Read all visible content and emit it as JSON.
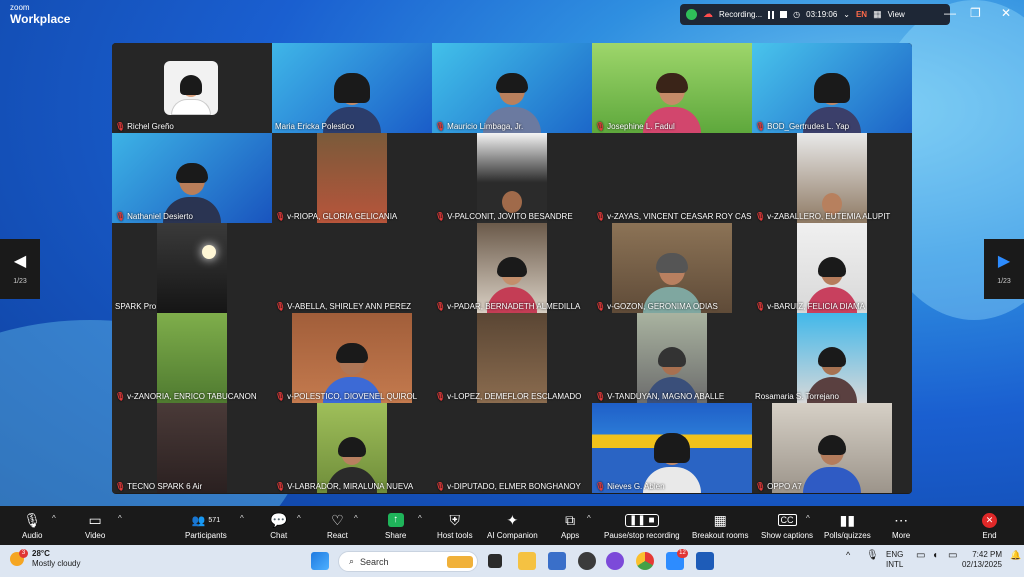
{
  "app": {
    "brand_top": "zoom",
    "brand_bottom": "Workplace"
  },
  "recording": {
    "label": "Recording...",
    "timer": "03:19:06",
    "language": "EN",
    "view_label": "View"
  },
  "navigation": {
    "left_page": "1/23",
    "right_page": "1/23"
  },
  "participants": [
    {
      "name": "Richel Greño"
    },
    {
      "name": "Maria Ericka Polestico"
    },
    {
      "name": "Mauricio Limbaga, Jr."
    },
    {
      "name": "Josephine L. Fadul"
    },
    {
      "name": "BOD_Gertrudes L. Yap"
    },
    {
      "name": "Nathaniel Desierto"
    },
    {
      "name": "v-RIOPA, GLORIA GELICANIA"
    },
    {
      "name": "V-PALCONIT, JOVITO BESANDRE"
    },
    {
      "name": "v-ZAYAS, VINCENT CEASAR ROY CAS..."
    },
    {
      "name": "v-ZABALLERO, EUTEMIA ALUPIT"
    },
    {
      "name": "SPARK Pro"
    },
    {
      "name": "V-ABELLA, SHIRLEY ANN PEREZ"
    },
    {
      "name": "v-PADAR, BERNADETH ALMEDILLA"
    },
    {
      "name": "v-GOZON, GERONIMA ODIAS"
    },
    {
      "name": "v-BARUIZ, FELICIA DIAMA"
    },
    {
      "name": "v-ZANORIA, ENRICO TABUCANON"
    },
    {
      "name": "v-POLESTICO, DIOVENEL QUIROL"
    },
    {
      "name": "v-LOPEZ, DEMEFLOR ESCLAMADO"
    },
    {
      "name": "V-TANDUYAN, MAGNO ABALLE"
    },
    {
      "name": "Rosamaria S. Torrejano"
    },
    {
      "name": "TECNO SPARK 6 Air"
    },
    {
      "name": "V-LABRADOR, MIRALUNA NUEVA"
    },
    {
      "name": "v-DIPUTADO, ELMER BONGHANOY"
    },
    {
      "name": "Nieves G. Ablen"
    },
    {
      "name": "OPPO A7"
    }
  ],
  "toolbar": {
    "audio": "Audio",
    "video": "Video",
    "participants": "Participants",
    "participant_count": "571",
    "chat": "Chat",
    "react": "React",
    "share": "Share",
    "host_tools": "Host tools",
    "ai_companion": "AI Companion",
    "apps": "Apps",
    "pause_recording": "Pause/stop recording",
    "breakout_rooms": "Breakout rooms",
    "show_captions": "Show captions",
    "polls": "Polls/quizzes",
    "more": "More",
    "end": "End"
  },
  "taskbar": {
    "weather_temp": "28°C",
    "weather_desc": "Mostly cloudy",
    "weather_badge": "3",
    "search_placeholder": "Search",
    "app_badge": "12",
    "lang_top": "ENG",
    "lang_bottom": "INTL",
    "time": "7:42 PM",
    "date": "02/13/2025"
  },
  "colors": {
    "active_speaker": "#2fc26e",
    "muted_mic": "#e23b3b",
    "end_button": "#e02828",
    "share_button": "#1fb45a"
  }
}
